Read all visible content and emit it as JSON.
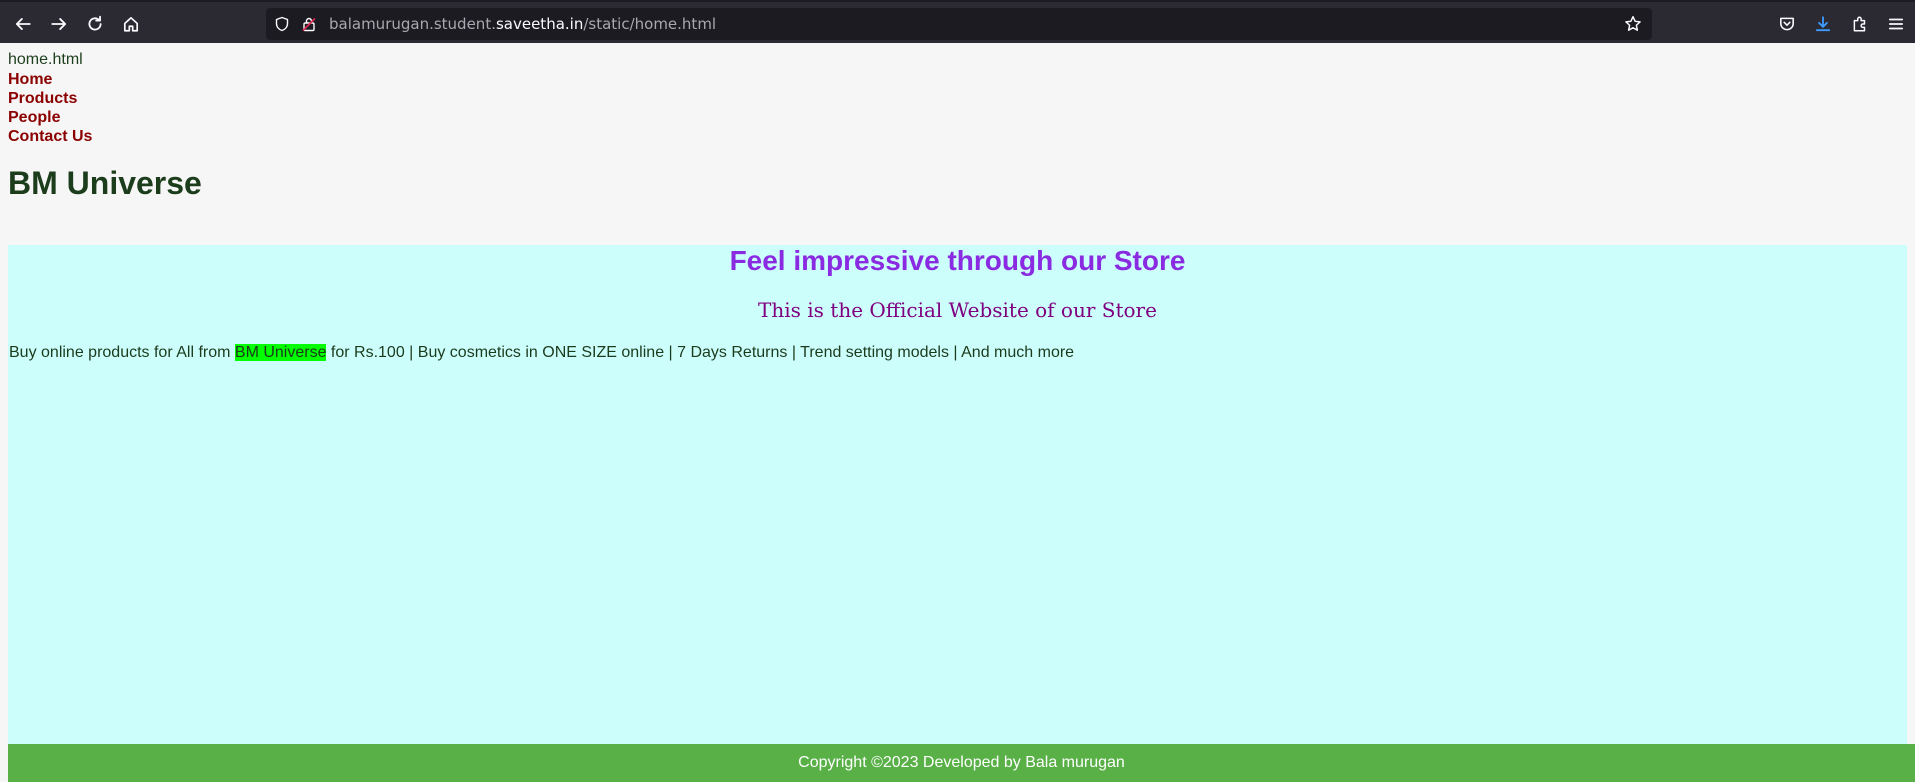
{
  "browser": {
    "url_prefix": "balamurugan.student.",
    "url_domain": "saveetha.in",
    "url_path": "/static/home.html"
  },
  "page": {
    "label": "home.html",
    "nav": [
      "Home",
      "Products",
      "People",
      "Contact Us"
    ],
    "site_title": "BM Universe",
    "headline": "Feel impressive through our Store",
    "subheadline": "This is the Official Website of our Store",
    "promo_before": "Buy online products for All from ",
    "promo_highlight": "BM Universe",
    "promo_after": " for Rs.100 | Buy cosmetics in ONE SIZE online | 7 Days Returns | Trend setting models | And much more",
    "footer": "Copyright ©2023 Developed by Bala murugan"
  },
  "colors": {
    "nav_link": "#8b0000",
    "headline": "#8a2be2",
    "subheadline": "#800080",
    "panel_bg": "#ccfffc",
    "highlight": "#00ff00",
    "footer_bg": "#58b046"
  },
  "icons": [
    "back-arrow-icon",
    "forward-arrow-icon",
    "reload-icon",
    "home-icon",
    "shield-icon",
    "lock-icon",
    "star-icon",
    "pocket-icon",
    "download-icon",
    "extensions-icon",
    "menu-icon"
  ]
}
